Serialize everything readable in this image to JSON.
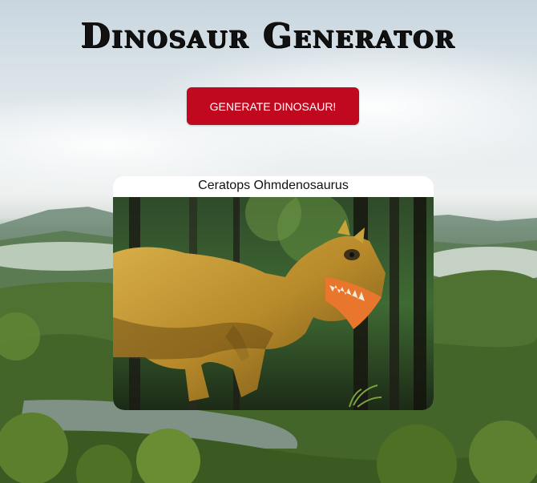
{
  "header": {
    "title": "Dinosaur Generator"
  },
  "actions": {
    "generate_label": "GENERATE DINOSAUR!"
  },
  "dinosaur": {
    "name": "Ceratops Ohmdenosaurus"
  },
  "colors": {
    "button_bg": "#c0081f",
    "button_text": "#ffffff",
    "card_bg": "#ffffff",
    "title_text": "#111111"
  }
}
